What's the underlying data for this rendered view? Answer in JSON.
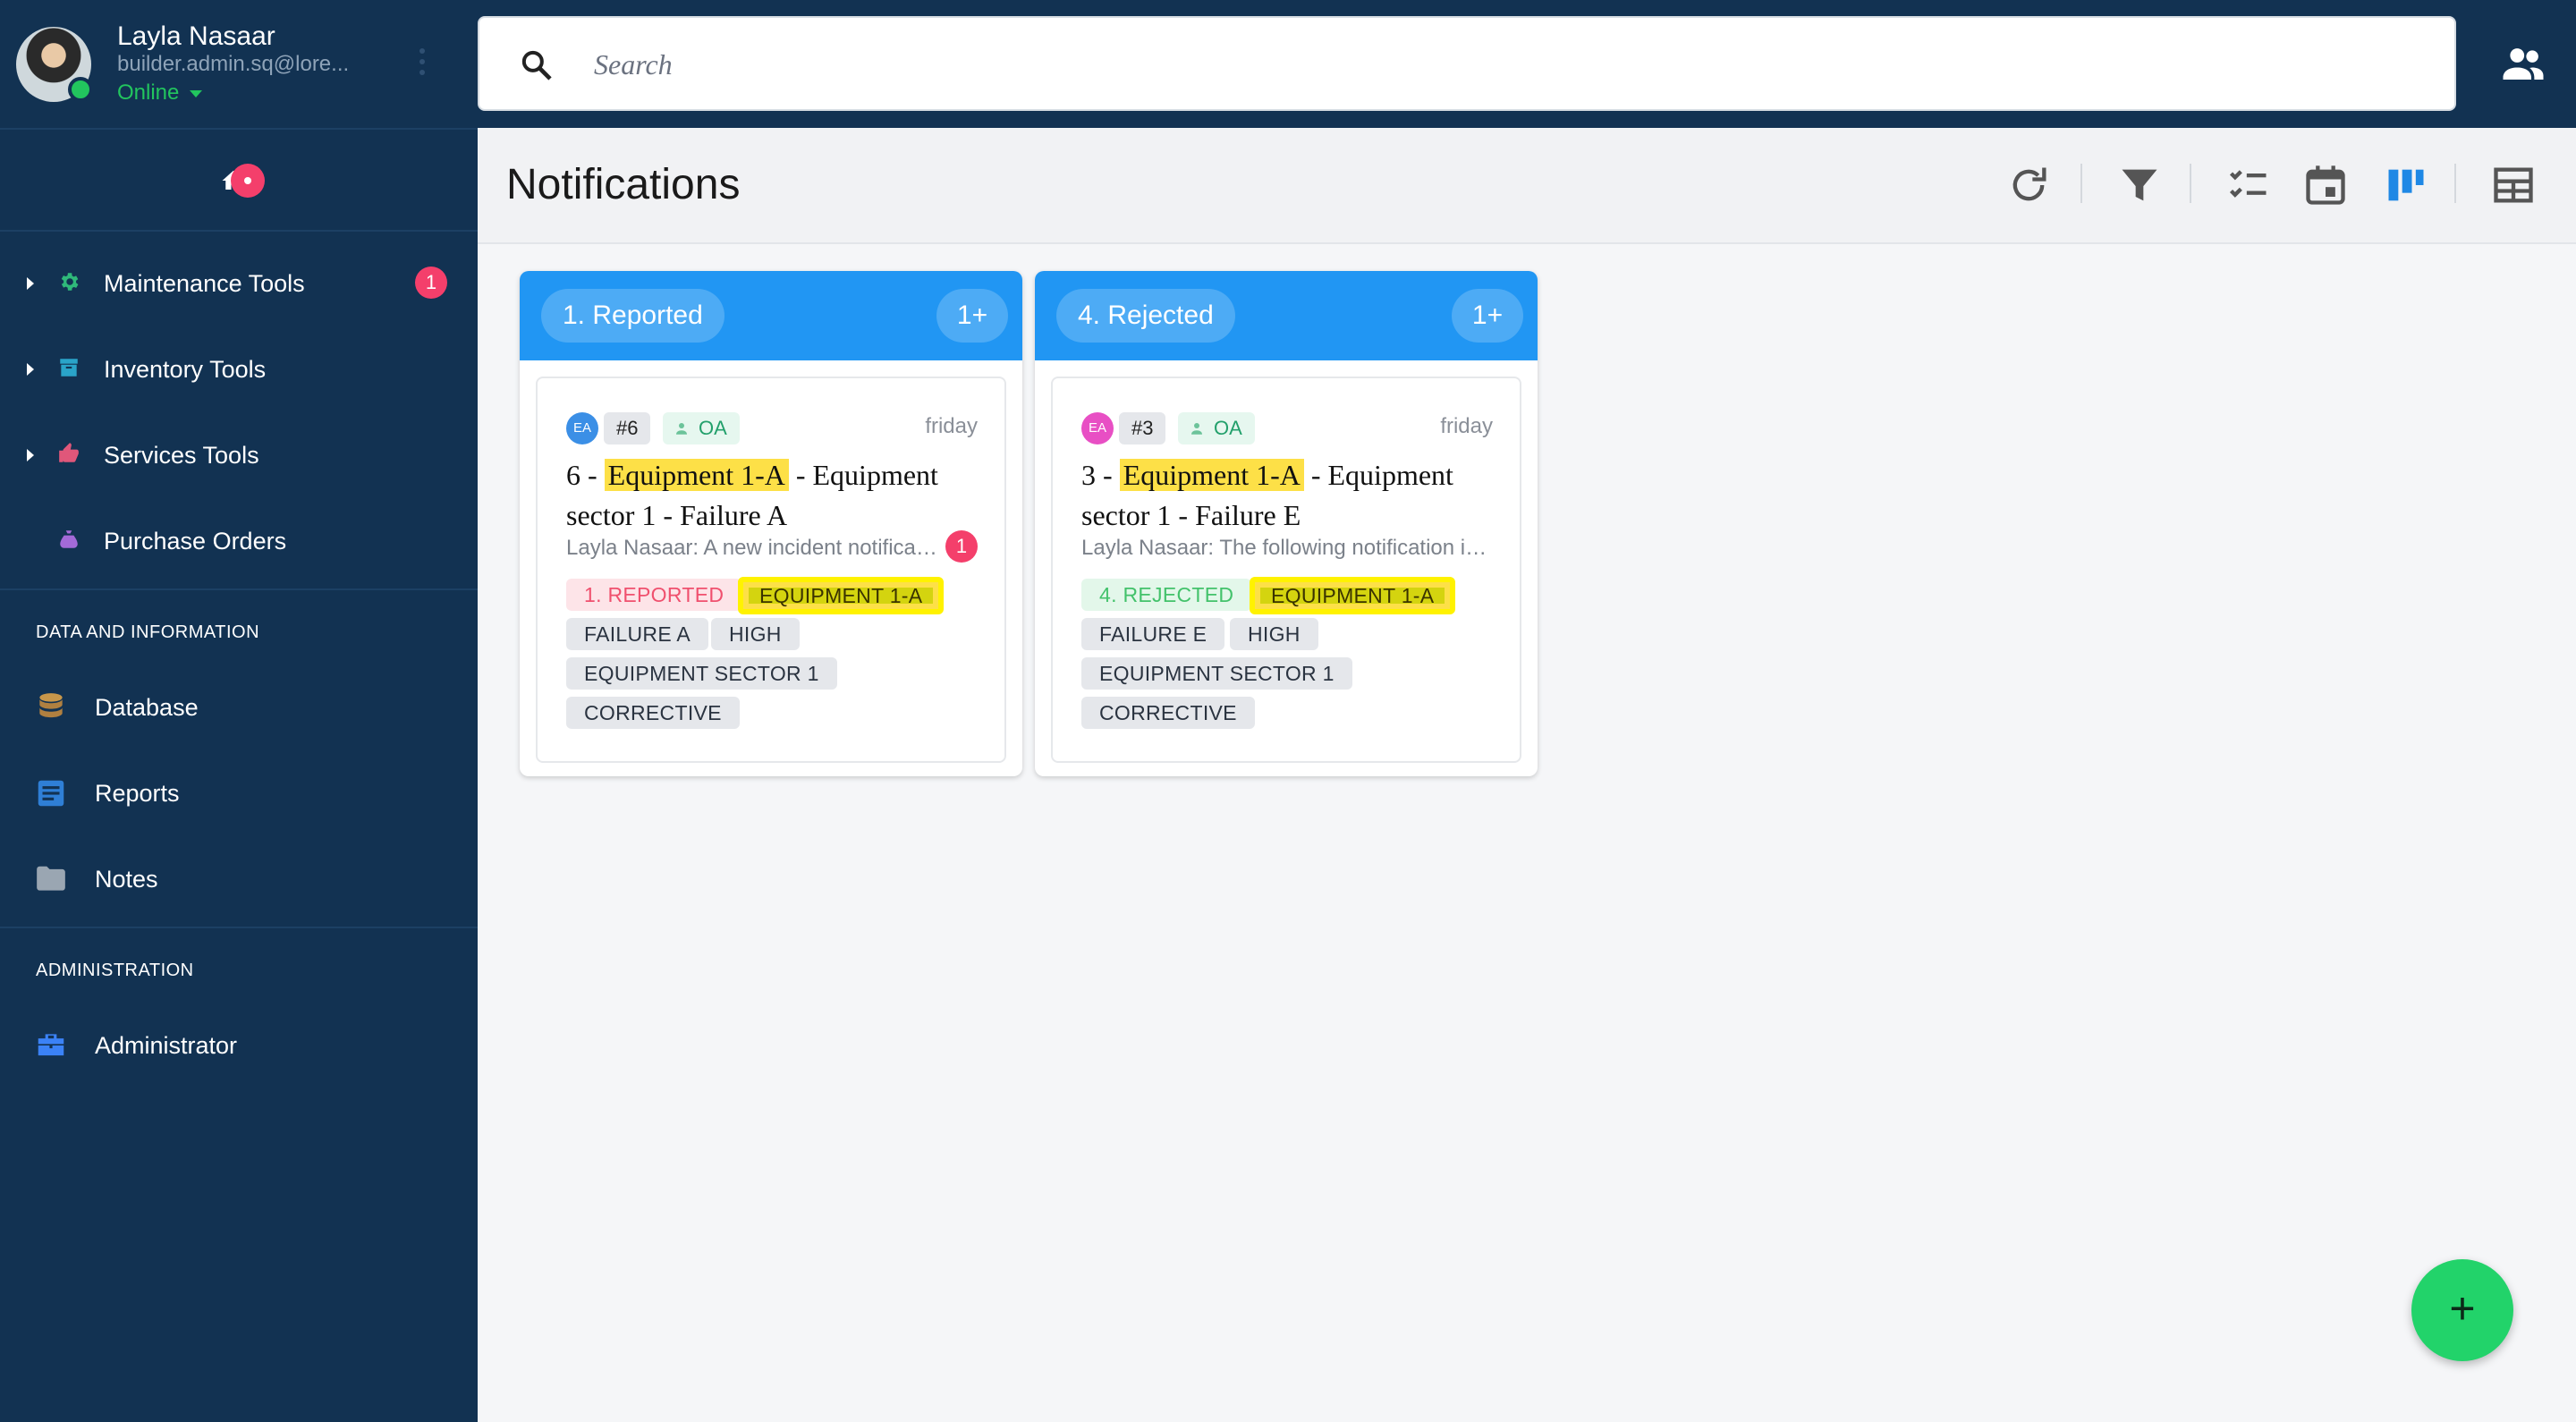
{
  "user": {
    "name": "Layla Nasaar",
    "email": "builder.admin.sq@lore...",
    "status": "Online"
  },
  "sidebar": {
    "items": [
      {
        "label": "Maintenance Tools",
        "icon": "gear-icon",
        "badge": "1"
      },
      {
        "label": "Inventory Tools",
        "icon": "archive-icon"
      },
      {
        "label": "Services Tools",
        "icon": "thumbs-up-icon"
      },
      {
        "label": "Purchase Orders",
        "icon": "money-bag-icon"
      }
    ],
    "section_data": "DATA AND INFORMATION",
    "data_items": [
      {
        "label": "Database",
        "icon": "database-icon"
      },
      {
        "label": "Reports",
        "icon": "document-icon"
      },
      {
        "label": "Notes",
        "icon": "folder-icon"
      }
    ],
    "section_admin": "ADMINISTRATION",
    "admin_items": [
      {
        "label": "Administrator",
        "icon": "toolbox-icon"
      }
    ]
  },
  "search": {
    "placeholder": "Search"
  },
  "header": {
    "title": "Notifications"
  },
  "columns": [
    {
      "title": "1. Reported",
      "count": "1+",
      "card": {
        "initials": "EA",
        "id": "#6",
        "assignee": "OA",
        "date": "friday",
        "title_prefix": "6 - ",
        "title_highlight": "Equipment 1-A",
        "title_suffix": " - Equipment sector 1 - Failure A",
        "description": "Layla Nasaar: A new incident notification was reported",
        "badge": "1",
        "tags": [
          "1. REPORTED",
          "EQUIPMENT 1-A",
          "FAILURE A",
          "HIGH",
          "EQUIPMENT SECTOR 1",
          "CORRECTIVE"
        ]
      }
    },
    {
      "title": "4. Rejected",
      "count": "1+",
      "card": {
        "initials": "EA",
        "id": "#3",
        "assignee": "OA",
        "date": "friday",
        "title_prefix": "3 - ",
        "title_highlight": "Equipment 1-A",
        "title_suffix": " - Equipment sector 1 - Failure E",
        "description": "Layla Nasaar: The following notification is rejected",
        "tags": [
          "4. REJECTED",
          "EQUIPMENT 1-A",
          "FAILURE E",
          "HIGH",
          "EQUIPMENT SECTOR 1",
          "CORRECTIVE"
        ]
      }
    }
  ],
  "fab": {
    "label": "+"
  },
  "colors": {
    "sidebar_bg": "#123252",
    "accent_blue": "#2196f3",
    "badge_red": "#f43f6b",
    "online_green": "#22c55e",
    "highlight_yellow": "#fde047"
  }
}
